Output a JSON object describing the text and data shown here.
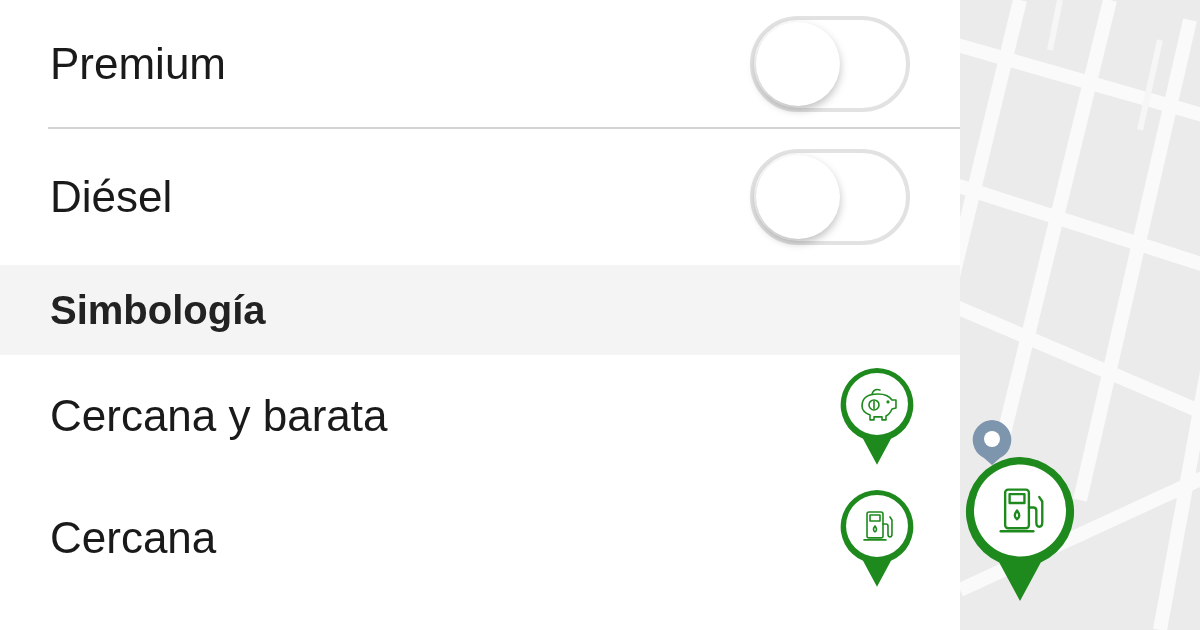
{
  "fuel_types": [
    {
      "label": "Premium",
      "on": false
    },
    {
      "label": "Diésel",
      "on": false
    }
  ],
  "legend": {
    "title": "Simbología",
    "items": [
      {
        "label": "Cercana y barata",
        "kind": "savings"
      },
      {
        "label": "Cercana",
        "kind": "pump"
      }
    ]
  }
}
